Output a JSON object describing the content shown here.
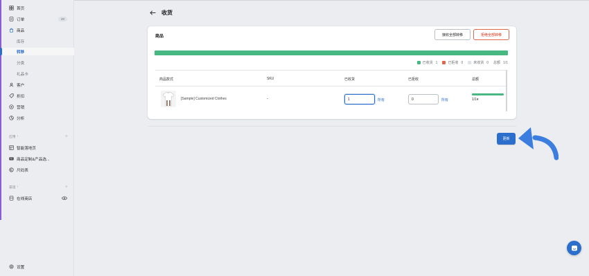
{
  "sidebar": {
    "items": [
      {
        "label": "首页",
        "icon": "home-icon"
      },
      {
        "label": "订单",
        "icon": "order-icon",
        "badge": "20"
      },
      {
        "label": "商品",
        "icon": "product-icon"
      },
      {
        "label": "库存"
      },
      {
        "label": "转移"
      },
      {
        "label": "分类"
      },
      {
        "label": "礼品卡"
      },
      {
        "label": "客户",
        "icon": "customer-icon"
      },
      {
        "label": "折扣",
        "icon": "discount-icon"
      },
      {
        "label": "营销",
        "icon": "marketing-icon"
      },
      {
        "label": "分析",
        "icon": "analytics-icon"
      }
    ],
    "apps_label": "应用",
    "apps": [
      {
        "label": "智能落地页",
        "icon": "landing-page-icon"
      },
      {
        "label": "商品定制&产品选...",
        "icon": "customization-icon"
      },
      {
        "label": "尺码表",
        "icon": "size-chart-icon"
      }
    ],
    "channels_label": "渠道",
    "channels": [
      {
        "label": "在线商店",
        "icon": "online-store-icon"
      }
    ],
    "settings_label": "设置"
  },
  "page": {
    "title": "收货"
  },
  "card": {
    "title": "商品",
    "accept_all_label": "接收全部转移",
    "reject_all_label": "拒绝全部转移",
    "progress_received_fraction": 1.0,
    "legend": {
      "received_label": "已收货",
      "received_count": "1",
      "rejected_label": "已拒收",
      "rejected_count": "0",
      "pending_label": "未收货",
      "pending_count": "0",
      "total_label": "总额",
      "total_value": "1/1"
    },
    "colors": {
      "received": "#47b881",
      "rejected": "#e3654d",
      "pending": "#dfe3e8"
    }
  },
  "table": {
    "headers": {
      "product": "商品款式",
      "sku": "SKU",
      "received": "已收货",
      "rejected": "已拒收",
      "total": "总额"
    },
    "rows": [
      {
        "product_name": "[Sample] Customized Clothes",
        "sku": "-",
        "received_value": "1",
        "received_all": "所有",
        "rejected_value": "0",
        "rejected_all": "所有",
        "total": "1/1▾"
      }
    ]
  },
  "update_label": "更新",
  "accent_color": "#2c6ecb"
}
